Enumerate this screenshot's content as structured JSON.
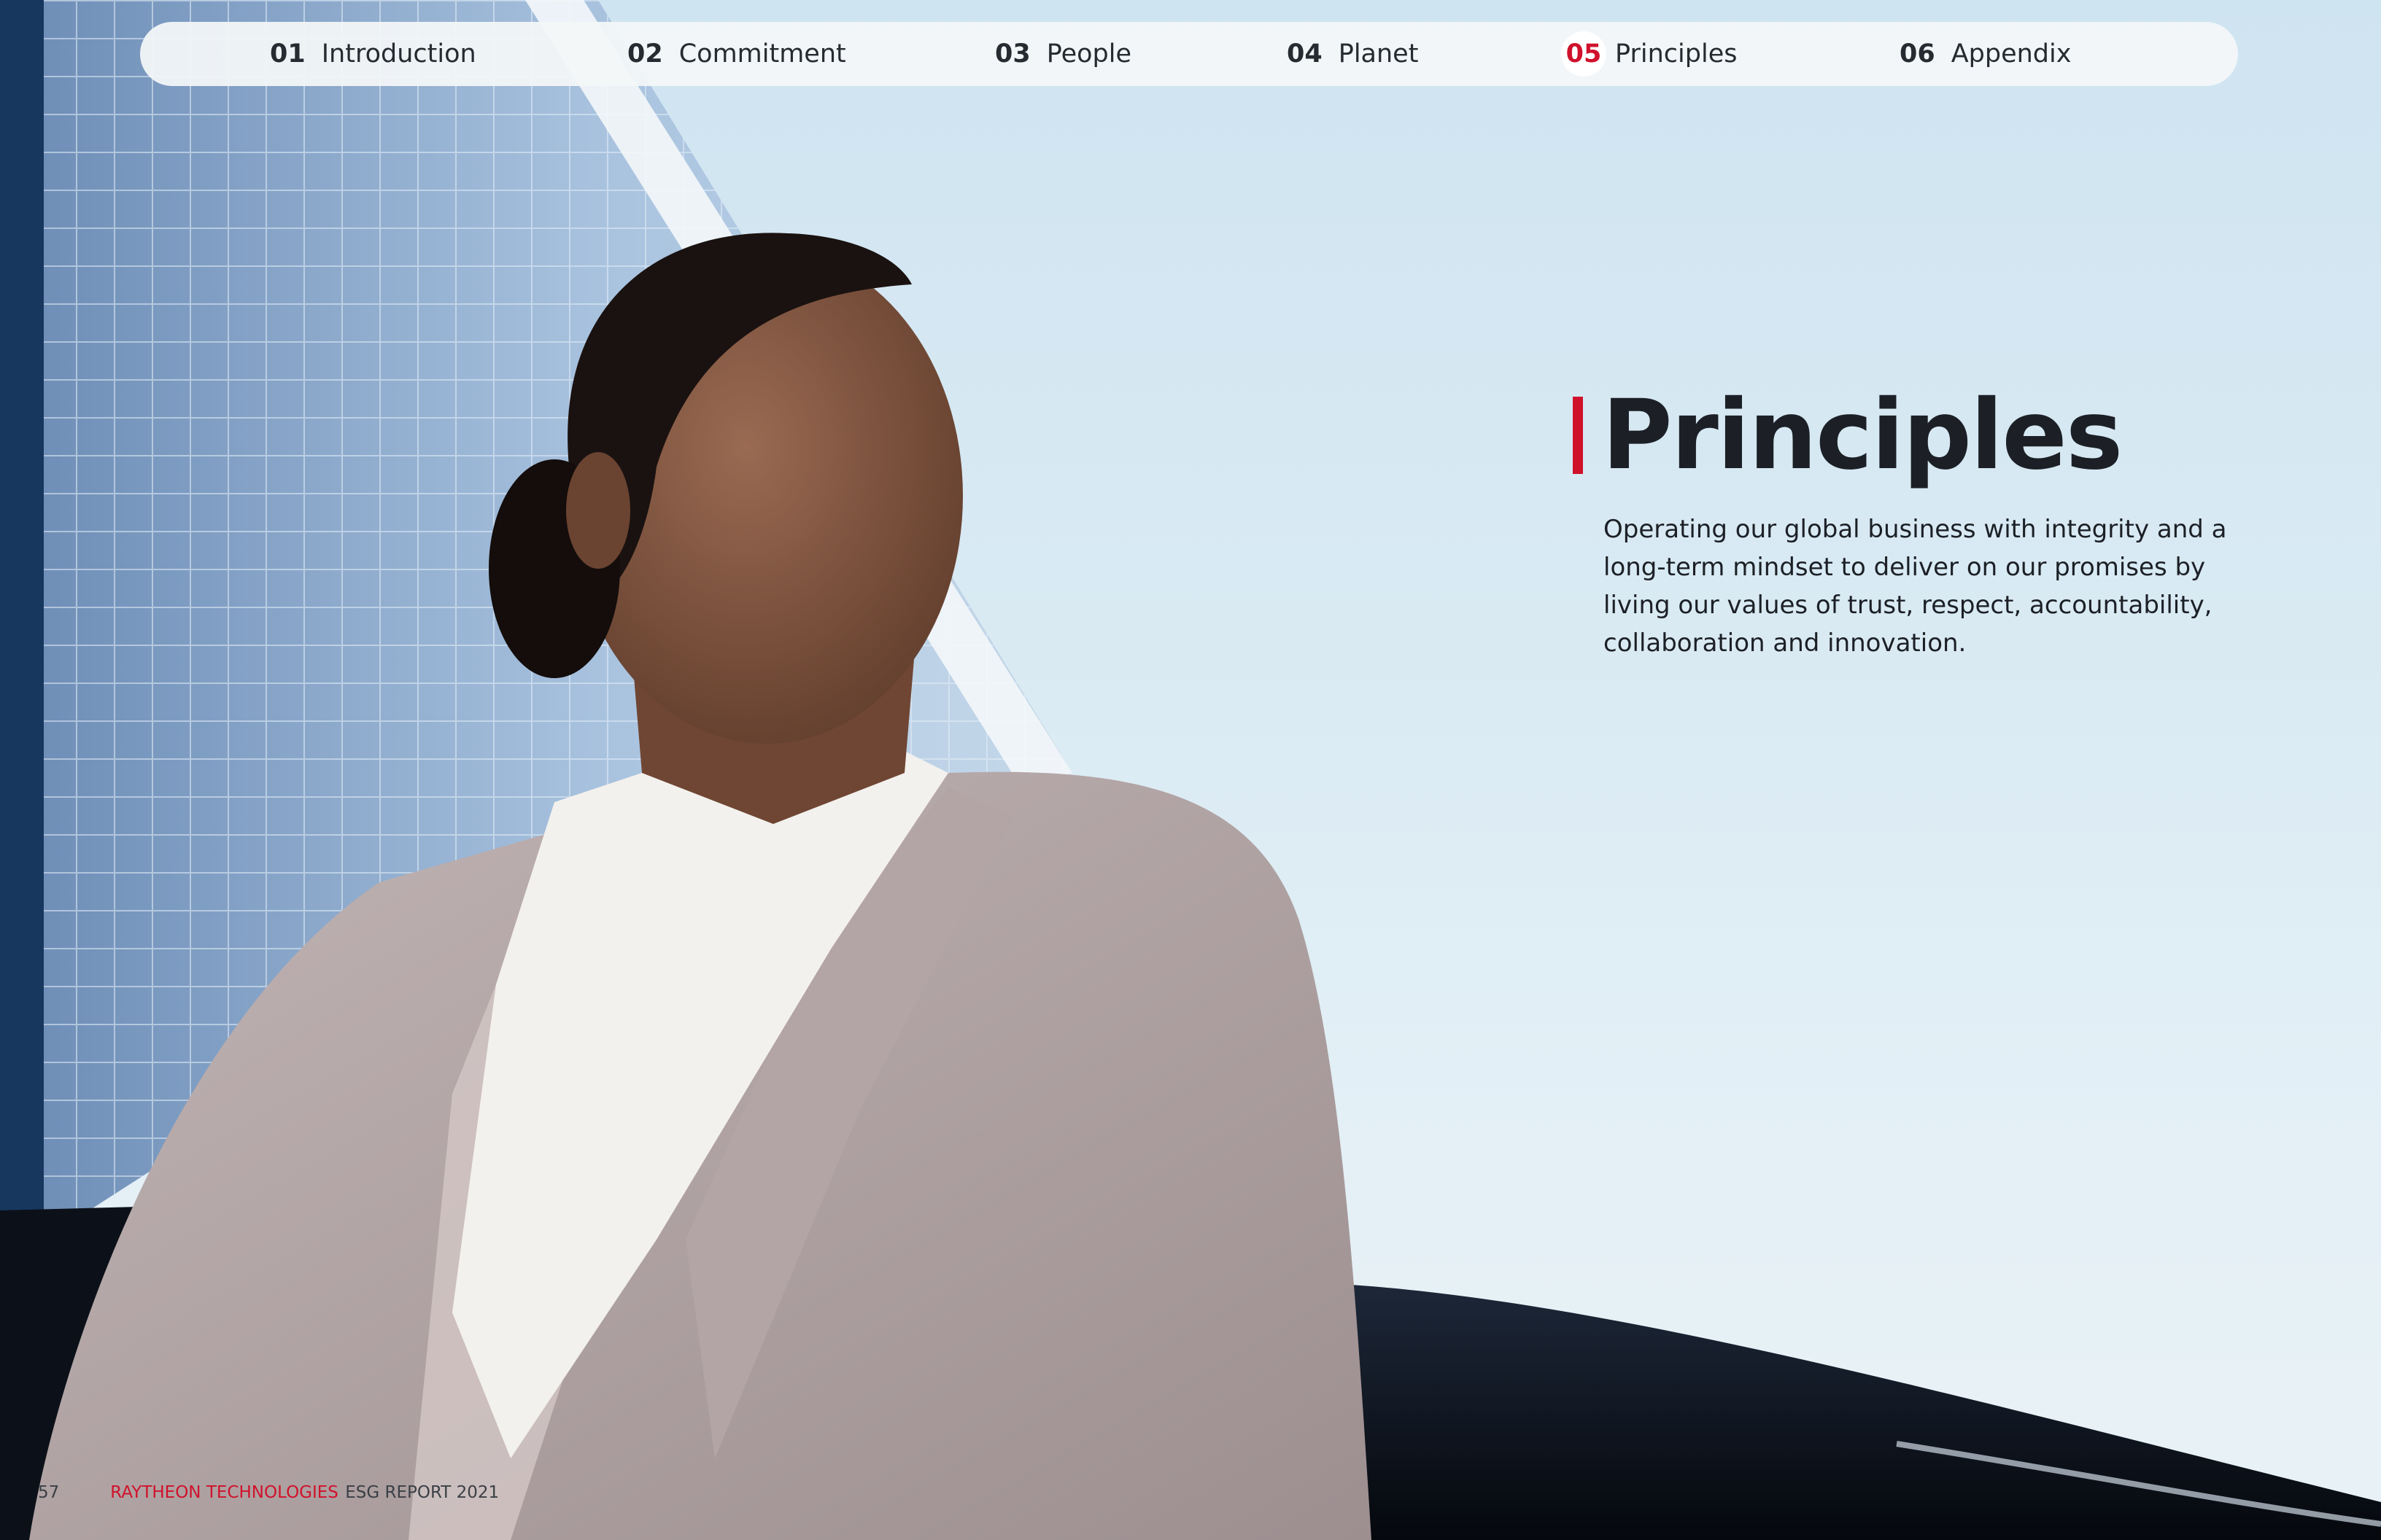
{
  "nav": {
    "items": [
      {
        "num": "01",
        "label": "Introduction"
      },
      {
        "num": "02",
        "label": "Commitment"
      },
      {
        "num": "03",
        "label": "People"
      },
      {
        "num": "04",
        "label": "Planet"
      },
      {
        "num": "05",
        "label": "Principles"
      },
      {
        "num": "06",
        "label": "Appendix"
      }
    ],
    "active_item": "05"
  },
  "section": {
    "title": "Principles",
    "intro": "Operating our global business with integrity and a long-term mindset to deliver on our promises by living our values of trust, respect, accountability, collaboration and innovation."
  },
  "footer": {
    "page_number": "57",
    "brand": "RAYTHEON TECHNOLOGIES",
    "report": "ESG REPORT 2021"
  },
  "colors": {
    "accent_red": "#d0112b",
    "text_dark": "#1c2026",
    "sky": "#d9eaf3"
  }
}
